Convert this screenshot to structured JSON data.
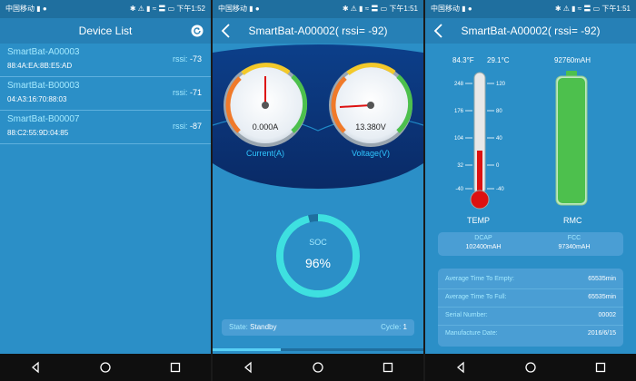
{
  "status": {
    "left_p1": "中国移动 ▮ ●",
    "right_p1": "✱ ⚠ ▮ ≈ 〓 ▭ 下午1:52",
    "left_p2": "中国移动 ▮ ●",
    "right_p2": "✱ ⚠ ▮ ≈ 〓 ▭ 下午1:51",
    "left_p3": "中国移动 ▮ ●",
    "right_p3": "✱ ⚠ ▮ ≈ 〓 ▭ 下午1:51"
  },
  "screen1": {
    "title": "Device List",
    "devices": [
      {
        "name": "SmartBat-A00003",
        "mac": "88:4A:EA:8B:E5:AD",
        "rssi_label": "rssi:",
        "rssi": "-73"
      },
      {
        "name": "SmartBat-B00003",
        "mac": "04:A3:16:70:88:03",
        "rssi_label": "rssi:",
        "rssi": "-71"
      },
      {
        "name": "SmartBat-B00007",
        "mac": "88:C2:55:9D:04:85",
        "rssi_label": "rssi:",
        "rssi": "-87"
      }
    ]
  },
  "screen2": {
    "title": "SmartBat-A00002( rssi= -92)",
    "current_value": "0.000A",
    "current_label": "Current(A)",
    "voltage_value": "13.380V",
    "voltage_label": "Voltage(V)",
    "soc_label": "SOC",
    "soc_value": "96%",
    "soc_fraction": 0.96,
    "state_label": "State:",
    "state_value": "Standby",
    "cycle_label": "Cycle:",
    "cycle_value": "1"
  },
  "screen3": {
    "title": "SmartBat-A00002( rssi= -92)",
    "temp_f": "84.3°F",
    "temp_c": "29.1°C",
    "rmc_value": "92760mAH",
    "temp_label": "TEMP",
    "rmc_label": "RMC",
    "therm_left_ticks": [
      "248",
      "176",
      "104",
      "32",
      "-40"
    ],
    "therm_right_ticks": [
      "120",
      "80",
      "40",
      "0",
      "-40"
    ],
    "dcap_label": "DCAP",
    "dcap_value": "102400mAH",
    "fcc_label": "FCC",
    "fcc_value": "97340mAH",
    "info": [
      {
        "k": "Average Time To Empty:",
        "v": "65535min"
      },
      {
        "k": "Average Time To Full:",
        "v": "65535min"
      },
      {
        "k": "Serial Number:",
        "v": "00002"
      },
      {
        "k": "Manufacture Date:",
        "v": "2016/6/15"
      }
    ]
  },
  "colors": {
    "bg": "#2b8fc7",
    "accent": "#a4eaff",
    "ring": "#3ee0e0"
  }
}
